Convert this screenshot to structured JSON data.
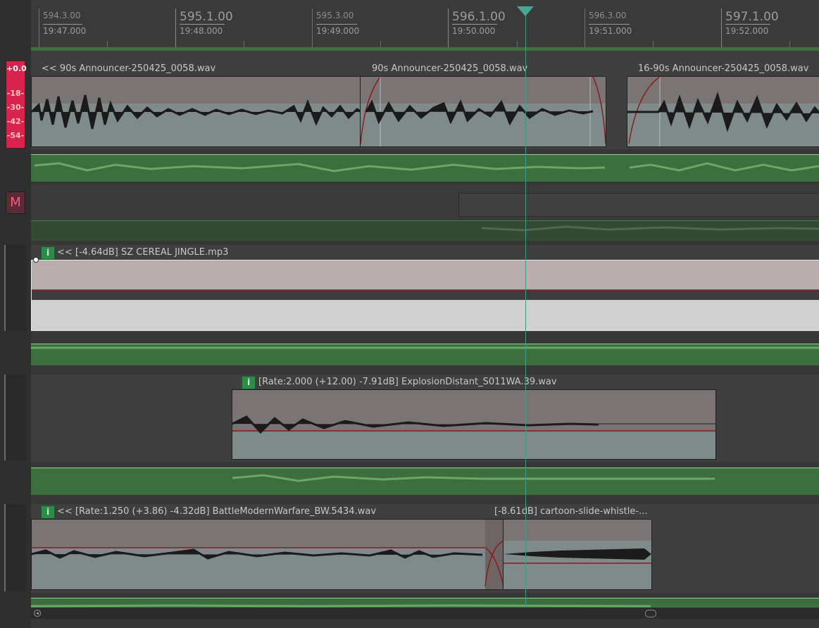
{
  "ruler": {
    "majors": [
      {
        "label": "595.1.00",
        "time": "19:48.000"
      },
      {
        "label": "596.1.00",
        "time": "19:50.000"
      },
      {
        "label": "597.1.00",
        "time": "19:52.000"
      }
    ],
    "minors": [
      {
        "label": "594.3.00",
        "time": "19:47.000"
      },
      {
        "label": "595.3.00",
        "time": "19:49.000"
      },
      {
        "label": "596.3.00",
        "time": "19:51.000"
      }
    ]
  },
  "meter": {
    "peak": "+0.0",
    "ticks": [
      "-18-",
      "-30-",
      "-42-",
      "-54-"
    ]
  },
  "mute_label": "M",
  "clips": {
    "announcer_a": "<< 90s Announcer-250425_0058.wav",
    "announcer_b": "90s Announcer-250425_0058.wav",
    "announcer_c": "16-90s Announcer-250425_0058.wav",
    "cereal": "<< [-4.64dB] SZ CEREAL JINGLE.mp3",
    "explosion": "[Rate:2.000 (+12.00) -7.91dB] ExplosionDistant_S011WA.39.wav",
    "battle": "<< [Rate:1.250 (+3.86) -4.32dB] BattleModernWarfare_BW.5434.wav",
    "whistle": "[-8.61dB] cartoon-slide-whistle-..."
  },
  "info_icon_glyph": "i",
  "colors": {
    "accent_green": "#3d6e3d",
    "playhead": "#44a796",
    "meter_red": "#d8234e",
    "info_green": "#2e8c49"
  }
}
